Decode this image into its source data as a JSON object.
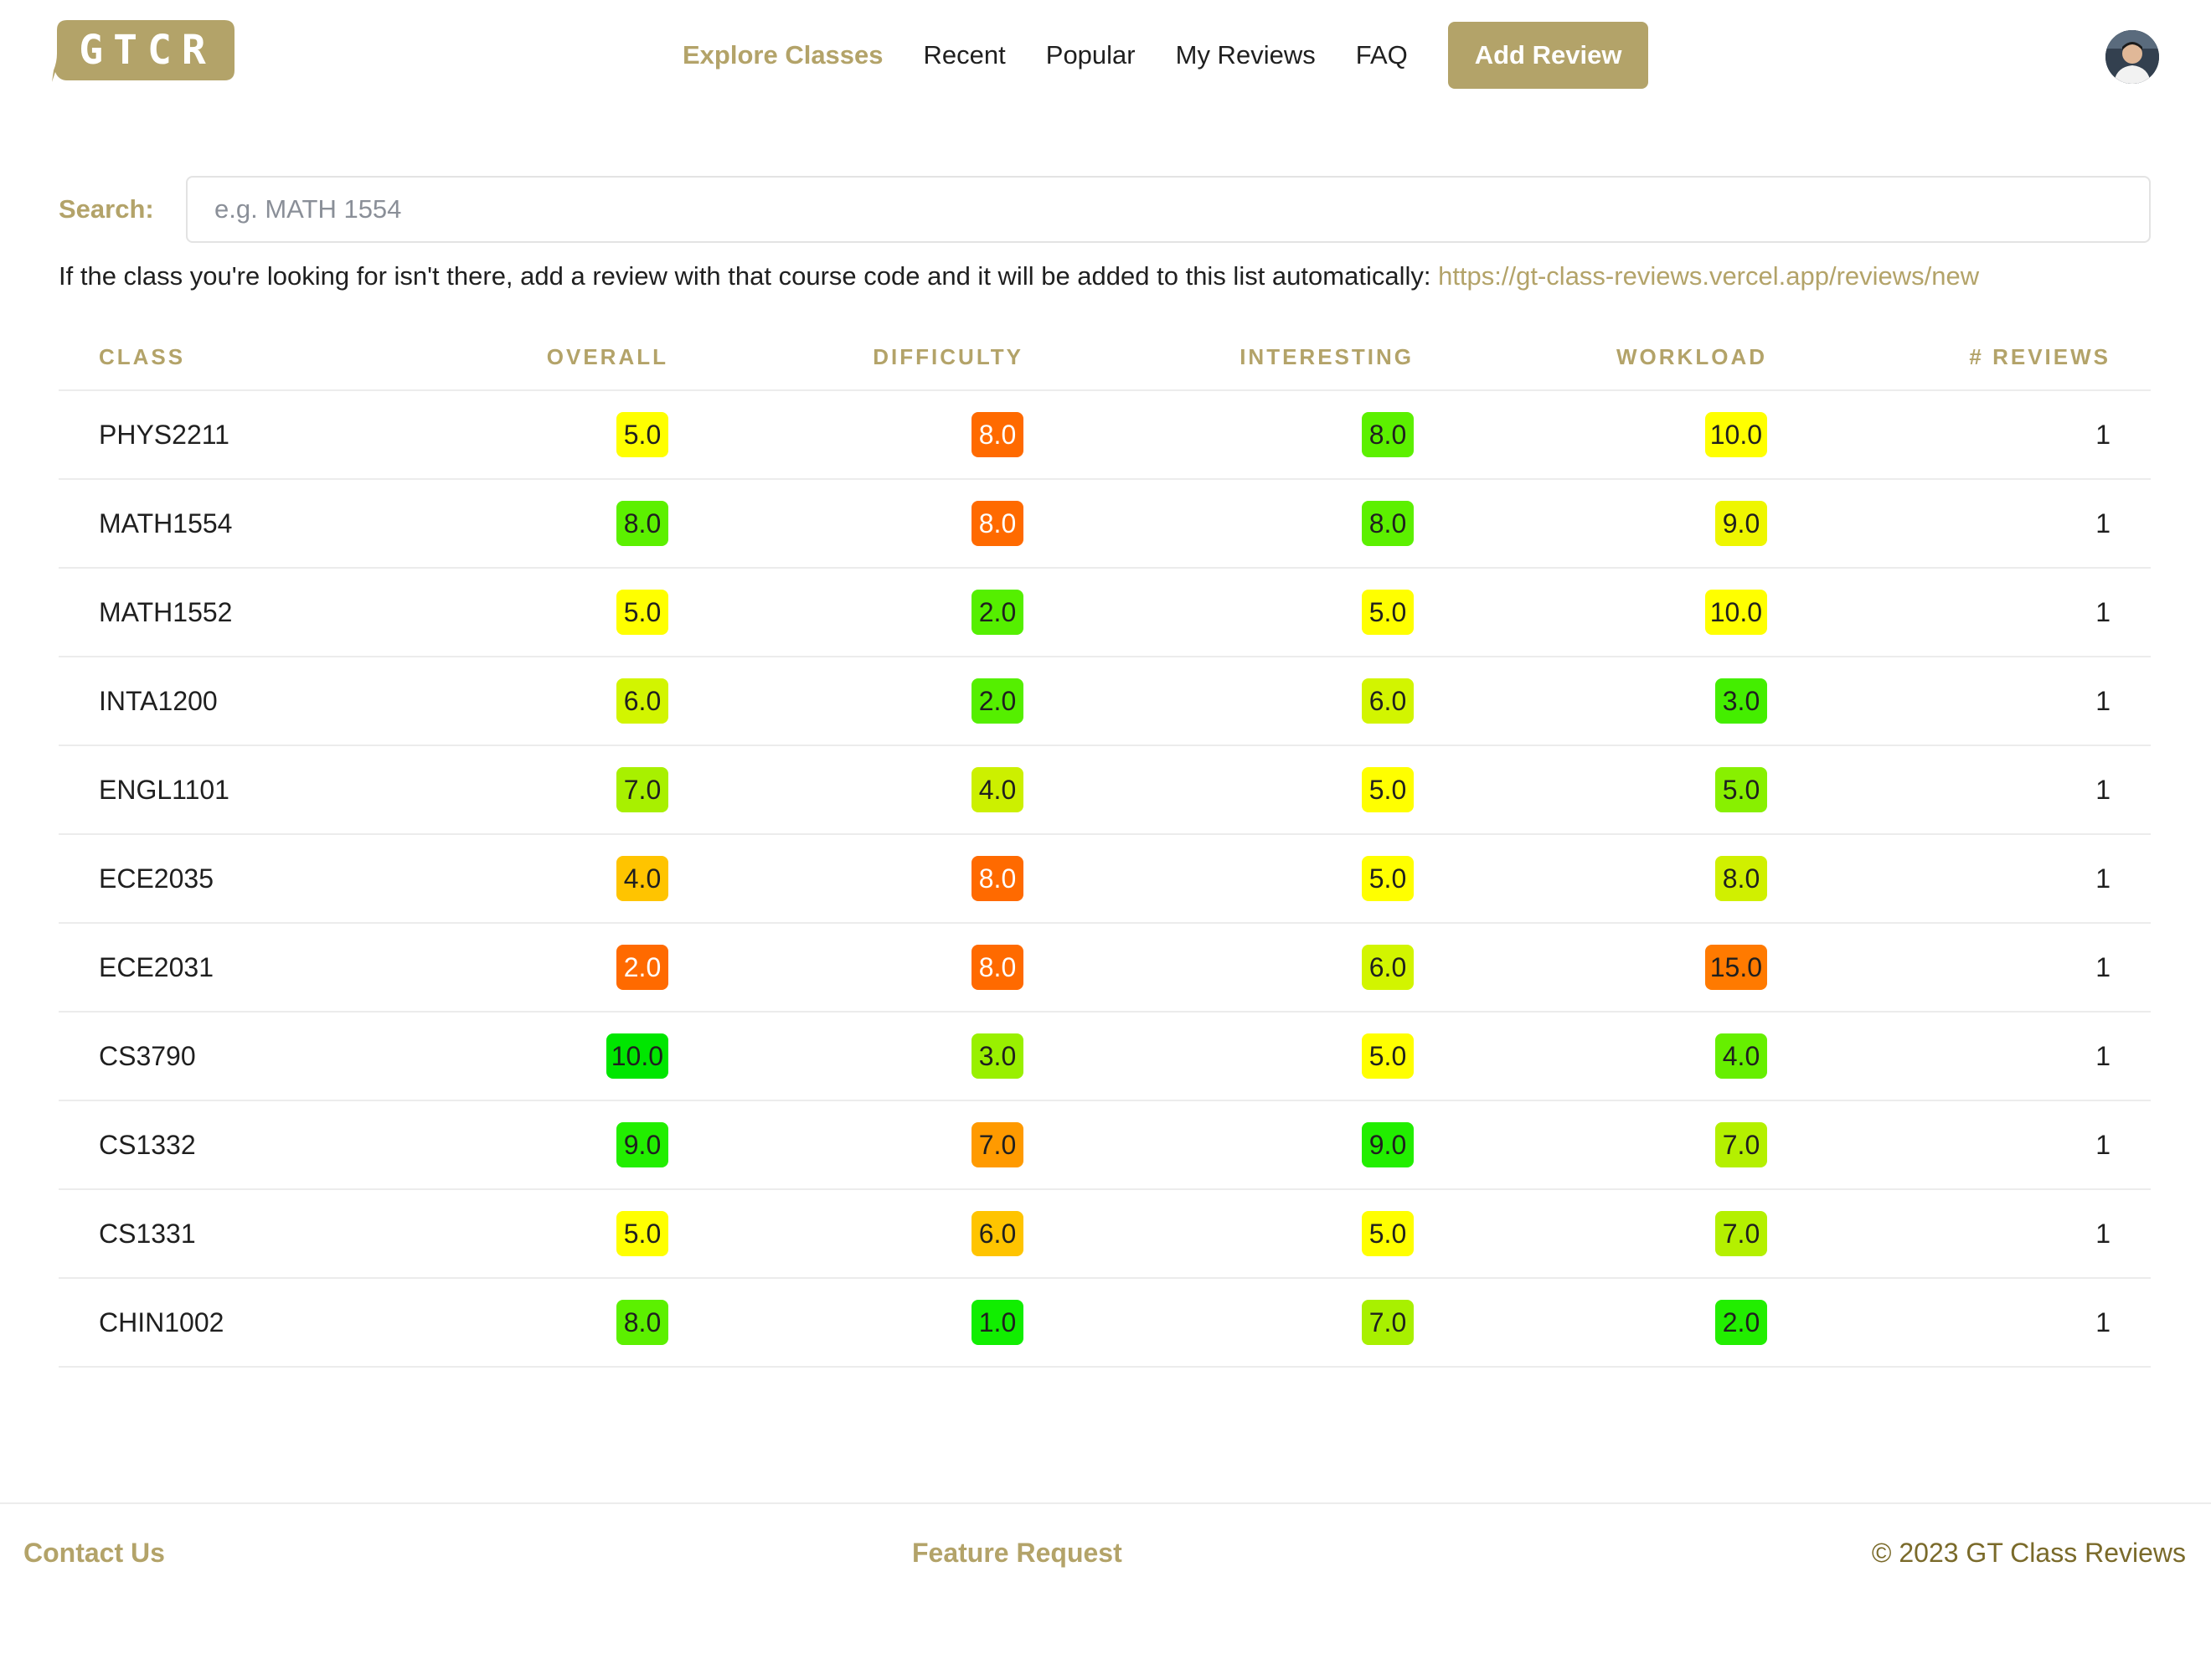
{
  "brand": {
    "logo_text": "GTCR",
    "accent_color": "#b3a369"
  },
  "nav": {
    "links": [
      {
        "label": "Explore Classes",
        "active": true
      },
      {
        "label": "Recent"
      },
      {
        "label": "Popular"
      },
      {
        "label": "My Reviews"
      },
      {
        "label": "FAQ"
      }
    ],
    "add_review_label": "Add Review",
    "avatar_icon": "user-avatar"
  },
  "search": {
    "label": "Search:",
    "placeholder": "e.g. MATH 1554",
    "value": ""
  },
  "hint": {
    "text": "If the class you're looking for isn't there, add a review with that course code and it will be added to this list automatically: ",
    "link_text": "https://gt-class-reviews.vercel.app/reviews/new"
  },
  "table": {
    "columns": [
      "CLASS",
      "OVERALL",
      "DIFFICULTY",
      "INTERESTING",
      "WORKLOAD",
      "# REVIEWS"
    ],
    "rows": [
      {
        "class": "PHYS2211",
        "overall": "5.0",
        "difficulty": "8.0",
        "interesting": "8.0",
        "workload": "10.0",
        "reviews": "1"
      },
      {
        "class": "MATH1554",
        "overall": "8.0",
        "difficulty": "8.0",
        "interesting": "8.0",
        "workload": "9.0",
        "reviews": "1"
      },
      {
        "class": "MATH1552",
        "overall": "5.0",
        "difficulty": "2.0",
        "interesting": "5.0",
        "workload": "10.0",
        "reviews": "1"
      },
      {
        "class": "INTA1200",
        "overall": "6.0",
        "difficulty": "2.0",
        "interesting": "6.0",
        "workload": "3.0",
        "reviews": "1"
      },
      {
        "class": "ENGL1101",
        "overall": "7.0",
        "difficulty": "4.0",
        "interesting": "5.0",
        "workload": "5.0",
        "reviews": "1"
      },
      {
        "class": "ECE2035",
        "overall": "4.0",
        "difficulty": "8.0",
        "interesting": "5.0",
        "workload": "8.0",
        "reviews": "1"
      },
      {
        "class": "ECE2031",
        "overall": "2.0",
        "difficulty": "8.0",
        "interesting": "6.0",
        "workload": "15.0",
        "reviews": "1"
      },
      {
        "class": "CS3790",
        "overall": "10.0",
        "difficulty": "3.0",
        "interesting": "5.0",
        "workload": "4.0",
        "reviews": "1"
      },
      {
        "class": "CS1332",
        "overall": "9.0",
        "difficulty": "7.0",
        "interesting": "9.0",
        "workload": "7.0",
        "reviews": "1"
      },
      {
        "class": "CS1331",
        "overall": "5.0",
        "difficulty": "6.0",
        "interesting": "5.0",
        "workload": "7.0",
        "reviews": "1"
      },
      {
        "class": "CHIN1002",
        "overall": "8.0",
        "difficulty": "1.0",
        "interesting": "7.0",
        "workload": "2.0",
        "reviews": "1"
      }
    ]
  },
  "score_colors": {
    "good": "#00e600",
    "ok": "#7cf300",
    "neutral": "#ffff00",
    "warn": "#ffc400",
    "bad": "#ff6a00"
  },
  "footer": {
    "contact_label": "Contact Us",
    "feature_label": "Feature Request",
    "copyright": "© 2023 GT Class Reviews"
  }
}
